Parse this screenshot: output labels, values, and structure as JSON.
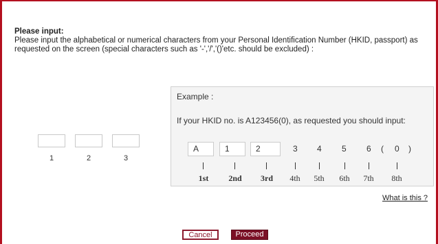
{
  "instructions": {
    "title": "Please input:",
    "body": "Please input the alphabetical or numerical characters from your Personal Identification Number (HKID, passport) as requested on the screen (special characters such as '-','/','()'etc. should be excluded) :"
  },
  "inputs": [
    {
      "label": "1",
      "value": ""
    },
    {
      "label": "2",
      "value": ""
    },
    {
      "label": "3",
      "value": ""
    }
  ],
  "example": {
    "title": "Example :",
    "description": "If your HKID no. is A123456(0), as requested you should input:",
    "characters": [
      "A",
      "1",
      "2",
      "3",
      "4",
      "5",
      "6",
      "(",
      "0",
      ")"
    ],
    "tick": "|",
    "ordinals": [
      "1st",
      "2nd",
      "3rd",
      "4th",
      "5th",
      "6th",
      "7th",
      "8th"
    ]
  },
  "links": {
    "what_is_this": "What is this ?"
  },
  "buttons": {
    "cancel": "Cancel",
    "proceed": "Proceed"
  },
  "colors": {
    "frame": "#b3101f",
    "proceed_bg": "#7b1026"
  }
}
